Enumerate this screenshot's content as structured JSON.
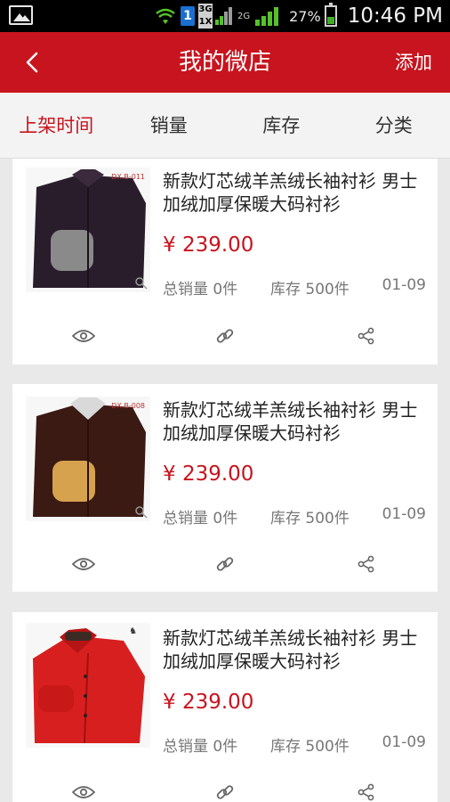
{
  "status_bar": {
    "network_top": "3G",
    "network_bottom": "1X",
    "network_2g": "2G",
    "battery": "27%",
    "time": "10:46 PM",
    "sim_label": "1"
  },
  "header": {
    "title": "我的微店",
    "add_label": "添加",
    "background": "#c8141e"
  },
  "tabs": [
    {
      "label": "上架时间",
      "active": true
    },
    {
      "label": "销量",
      "active": false
    },
    {
      "label": "库存",
      "active": false
    },
    {
      "label": "分类",
      "active": false
    }
  ],
  "products": [
    {
      "name": "新款灯芯绒羊羔绒长袖衬衫 男士加绒加厚保暖大码衬衫",
      "price": "¥ 239.00",
      "sales": "总销量 0件",
      "stock": "库存 500件",
      "date": "01-09",
      "shirt_color": "#2a1d2b",
      "cuff_color": "#8a8a8a",
      "image_tag": "DX.B-011"
    },
    {
      "name": "新款灯芯绒羊羔绒长袖衬衫 男士加绒加厚保暖大码衬衫",
      "price": "¥ 239.00",
      "sales": "总销量 0件",
      "stock": "库存 500件",
      "date": "01-09",
      "shirt_color": "#3a1a12",
      "cuff_color": "#d7a24e",
      "image_tag": "DX.B-008"
    },
    {
      "name": "新款灯芯绒羊羔绒长袖衬衫 男士加绒加厚保暖大码衬衫",
      "price": "¥ 239.00",
      "sales": "总销量 0件",
      "stock": "库存 500件",
      "date": "01-09",
      "shirt_color": "#d81f1f",
      "cuff_color": "#c81818",
      "image_tag": ""
    }
  ],
  "colors": {
    "accent": "#c8141e",
    "tab_bar": "#f3f3f3",
    "background": "#e9e9e9"
  }
}
